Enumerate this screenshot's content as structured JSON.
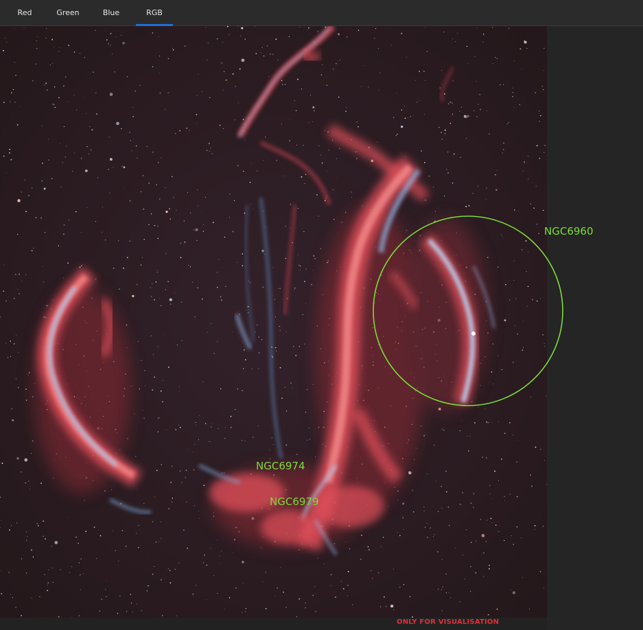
{
  "tabs": [
    {
      "label": "Red",
      "active": false
    },
    {
      "label": "Green",
      "active": false
    },
    {
      "label": "Blue",
      "active": false
    },
    {
      "label": "RGB",
      "active": true
    }
  ],
  "image": {
    "description_icon": "nebula-image",
    "annotations": {
      "ngc6960": "NGC6960",
      "ngc6974": "NGC6974",
      "ngc6979": "NGC6979"
    },
    "watermark": "ONLY FOR VISUALISATION"
  },
  "colors": {
    "accent_tab": "#1f6fd6",
    "annotation": "#7ddc3a",
    "watermark": "#e0303a",
    "nebula_red": "#e0505a",
    "nebula_blue": "#7fa8d8",
    "sky": "#2a1b1e"
  }
}
